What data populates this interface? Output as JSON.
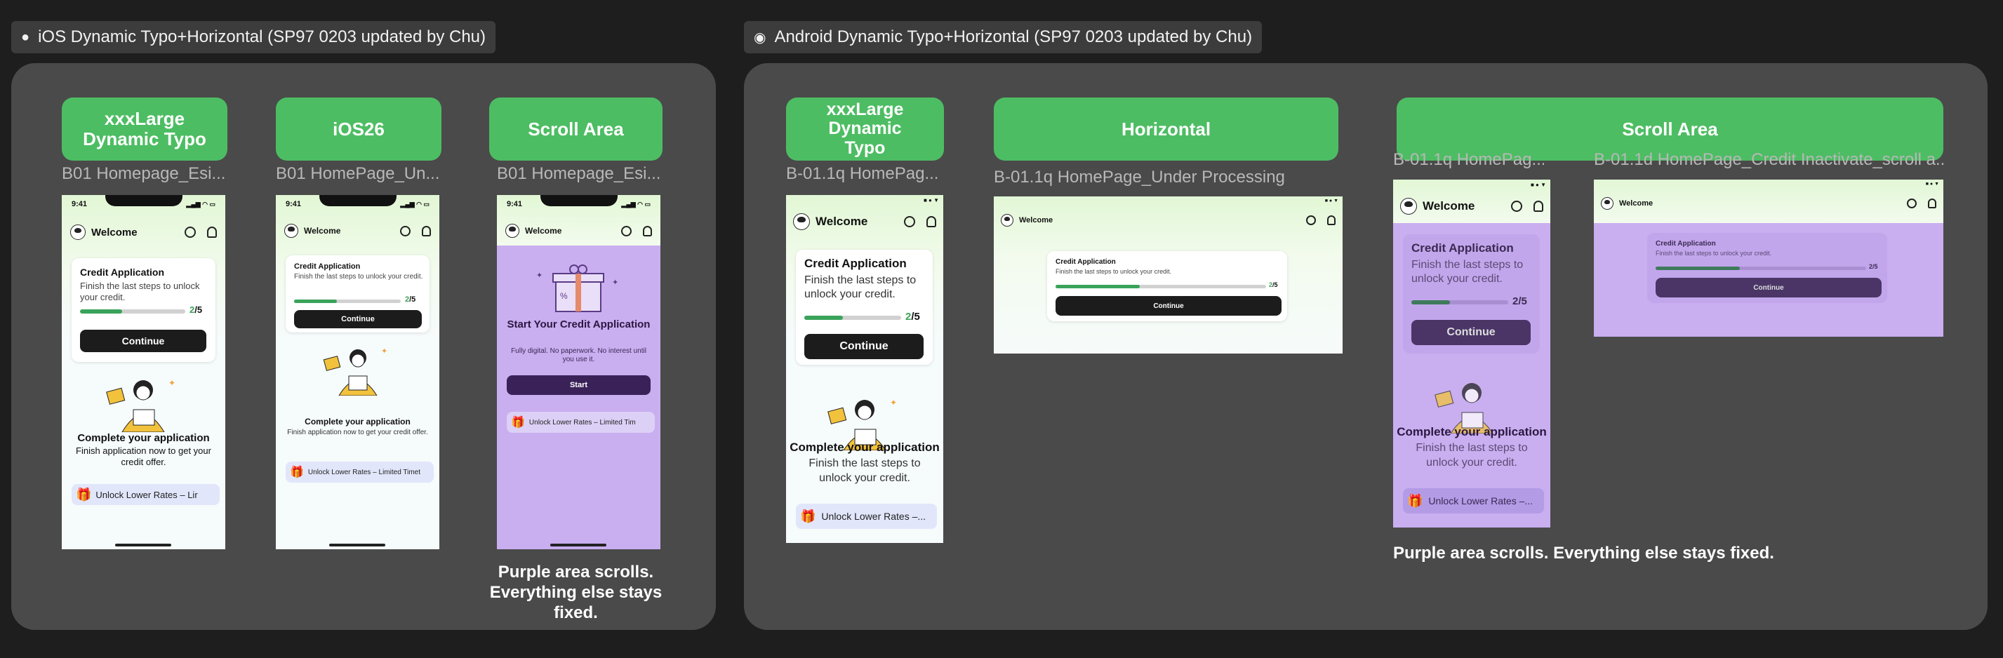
{
  "sections": {
    "ios": {
      "icon": "apple-icon",
      "title": "iOS Dynamic Typo+Horizontal (SP97 0203 updated by Chu)"
    },
    "android": {
      "icon": "android-icon",
      "title": "Android Dynamic Typo+Horizontal (SP97 0203 updated by Chu)"
    }
  },
  "ios": {
    "col1": {
      "pill": "xxxLarge\nDynamic Typo",
      "frame_label": "B01 Homepage_Esi..."
    },
    "col2": {
      "pill": "iOS26",
      "frame_label": "B01 HomePage_Un..."
    },
    "col3": {
      "pill": "Scroll Area",
      "frame_label": "B01 Homepage_Esi..."
    },
    "note": "Purple area scrolls.\nEverything else stays fixed."
  },
  "android": {
    "col1": {
      "pill": "xxxLarge\nDynamic\nTypo",
      "frame_label": "B-01.1q HomePag..."
    },
    "col2": {
      "pill": "Horizontal",
      "frame_label": "B-01.1q HomePage_Under Processing"
    },
    "col3": {
      "pill": "Scroll Area",
      "frame_label_a": "B-01.1q HomePag...",
      "frame_label_b": "B-01.1d HomePage_Credit Inactivate_scroll a..."
    },
    "note": "Purple area scrolls. Everything else stays fixed."
  },
  "phone": {
    "time": "9:41",
    "welcome": "Welcome",
    "card_title": "Credit Application",
    "card_sub": "Finish the last steps to unlock your credit.",
    "progress_cur": "2",
    "progress_total": "/5",
    "progress_value": 0.4,
    "continue": "Continue",
    "complete_title": "Complete your application",
    "complete_sub_ios": "Finish application now to get your credit offer.",
    "complete_sub_android": "Finish the last steps to unlock your credit.",
    "promo_full": "Unlock Lower Rates – Limited Time",
    "promo_short": "Unlock Lower Rates –...",
    "promo_cut": "Unlock Lower Rates – Lir",
    "promo_cut2": "Unlock Lower Rates – Limited Timet",
    "promo_cut3": "Unlock Lower Rates – Limited Tim",
    "start_title": "Start Your Credit Application",
    "start_sub": "Fully digital. No paperwork. No interest until you use it.",
    "start_btn": "Start"
  },
  "colors": {
    "accent_green": "#4dbd63",
    "scroll_purple": "#c9aef0",
    "progress_green": "#3aa35a"
  }
}
